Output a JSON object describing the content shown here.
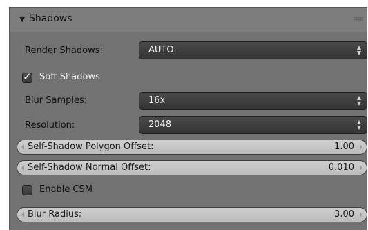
{
  "panel": {
    "title": "Shadows",
    "collapse_glyph": "▼"
  },
  "render_shadows": {
    "label": "Render Shadows:",
    "value": "AUTO"
  },
  "soft_shadows": {
    "label": "Soft Shadows",
    "checked": true,
    "check_glyph": "✓"
  },
  "blur_samples": {
    "label": "Blur Samples:",
    "value": "16x"
  },
  "resolution": {
    "label": "Resolution:",
    "value": "2048"
  },
  "polygon_offset": {
    "label": "Self-Shadow Polygon Offset:",
    "value": "1.00"
  },
  "normal_offset": {
    "label": "Self-Shadow Normal Offset:",
    "value": "0.010"
  },
  "enable_csm": {
    "label": "Enable CSM",
    "checked": false
  },
  "blur_radius": {
    "label": "Blur Radius:",
    "value": "3.00"
  },
  "colors": {
    "panel_bg": "#727272",
    "dropdown_bg": "#3f3f3f",
    "slider_bg": "#c4c4c4"
  }
}
